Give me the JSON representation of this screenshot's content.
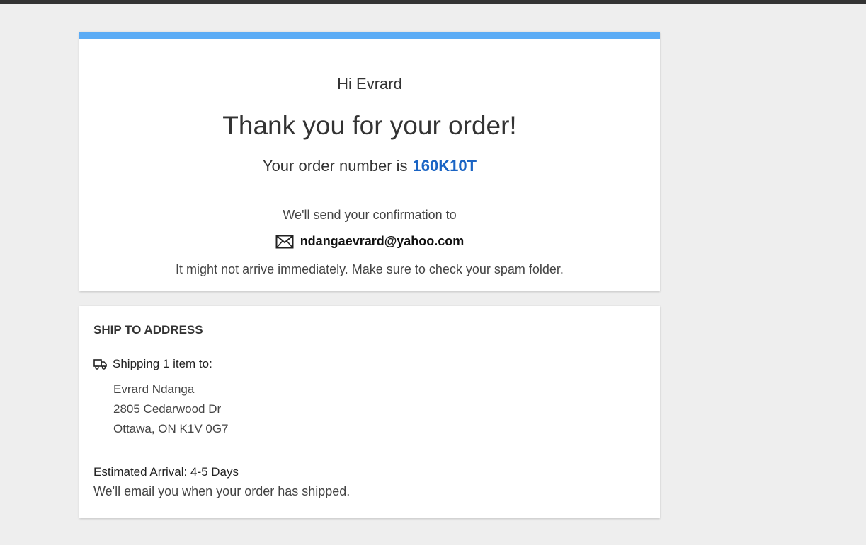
{
  "confirmation": {
    "greeting": "Hi Evrard",
    "headline": "Thank you for your order!",
    "order_prefix": "Your order number is",
    "order_number": "160K10T",
    "send_to_text": "We'll send your confirmation to",
    "email": "ndangaevrard@yahoo.com",
    "spam_note": "It might not arrive immediately. Make sure to check your spam folder."
  },
  "shipping": {
    "title": "SHIP TO ADDRESS",
    "items_label": "Shipping 1 item to:",
    "address_lines": [
      "Evrard Ndanga",
      "2805 Cedarwood Dr",
      "Ottawa, ON K1V 0G7"
    ],
    "arrival": "Estimated Arrival: 4-5 Days",
    "email_note": "We'll email you when your order has shipped."
  },
  "icons": {
    "mail": "envelope-icon",
    "shipping": "truck-icon"
  },
  "colors": {
    "accent_bar": "#5aabf5",
    "order_number": "#1a64c4",
    "page_background": "#eeeeee"
  }
}
